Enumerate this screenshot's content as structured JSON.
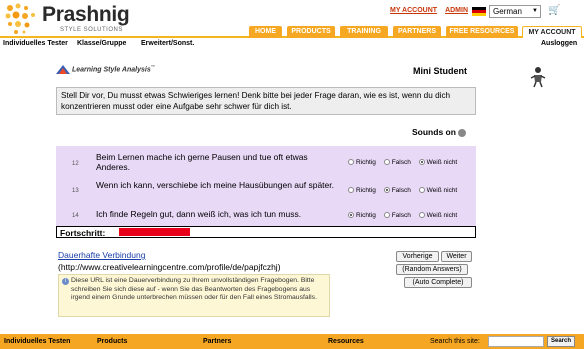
{
  "logo": {
    "name": "Prashnig",
    "subtitle": "STYLE SOLUTIONS"
  },
  "toplinks": {
    "my_account": "MY ACCOUNT",
    "admin": "ADMIN"
  },
  "language": {
    "selected": "German"
  },
  "nav": [
    "HOME",
    "PRODUCTS",
    "TRAINING",
    "PARTNERS",
    "FREE RESOURCES",
    "MY ACCOUNT"
  ],
  "subnav": {
    "items": [
      "Individuelles Tester",
      "Klasse/Gruppe",
      "Erweitert/Sonst."
    ],
    "logout": "Ausloggen"
  },
  "lsa_logo": "Learning Style Analysis",
  "mini_student": "Mini Student",
  "intro_text": "Stell Dir vor, Du musst etwas Schwieriges lernen! Denk bitte bei jeder Frage daran, wie es ist, wenn du dich konzentrieren musst oder eine Aufgabe sehr schwer für dich ist.",
  "sounds_label": "Sounds on",
  "radio_labels": [
    "Richtig",
    "Falsch",
    "Weiß nicht"
  ],
  "questions": [
    {
      "num": "12",
      "text": "Beim Lernen mache ich gerne Pausen und tue oft etwas Anderes.",
      "selected": "Weiß nicht"
    },
    {
      "num": "13",
      "text": "Wenn ich kann, verschiebe ich meine Hausübungen auf später.",
      "selected": "Falsch"
    },
    {
      "num": "14",
      "text": "Ich finde Regeln gut, dann weiß ich, was ich tun muss.",
      "selected": "Richtig"
    }
  ],
  "progress": {
    "label": "Fortschritt:",
    "fraction": 0.2
  },
  "permanent_link": "Dauerhafte Verbindung",
  "permanent_url": "(http://www.creativelearningcentre.com/profile/de/papjfczhj)",
  "note": "Diese URL ist eine Dauerverbindung zu Ihrem unvollständigen Fragebogen. Bitte schreiben Sie sich diese auf - wenn Sie das Beantworten des Fragebogens aus irgend einem Grunde unterbrechen müssen oder für den Fall eines Stromausfalls.",
  "buttons": {
    "prev": "Vorherige",
    "next": "Weiter",
    "random": "(Random Answers)",
    "auto": "(Auto Complete)"
  },
  "footer": {
    "items": [
      "Individuelles Testen",
      "Products",
      "Partners",
      "Resources"
    ],
    "search_label": "Search this site:",
    "search_button": "Search"
  },
  "colors": {
    "accent": "#f5a623",
    "question_bg": "#e8d9f7",
    "progress": "#e8001a"
  }
}
